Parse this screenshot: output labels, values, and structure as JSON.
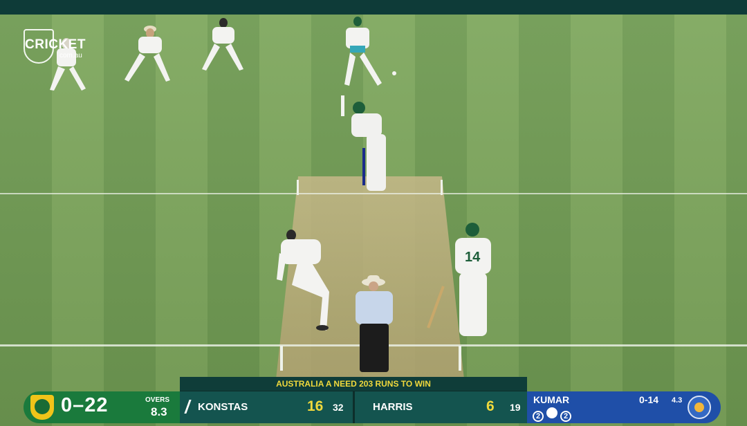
{
  "broadcast": {
    "logo_text": "CRICKET",
    "logo_sub": "com.au"
  },
  "scoreboard": {
    "team_score": "0–22",
    "overs_label": "OVERS",
    "overs_value": "8.3",
    "target_message": "AUSTRALIA A NEED 203 RUNS TO WIN",
    "batters": [
      {
        "name": "KONSTAS",
        "runs": "16",
        "balls": "32",
        "on_strike": true
      },
      {
        "name": "HARRIS",
        "runs": "6",
        "balls": "19",
        "on_strike": false
      }
    ],
    "bowler": {
      "name": "KUMAR",
      "figures": "0-14",
      "overs": "4.3",
      "this_over": [
        "2",
        "•",
        "2"
      ]
    }
  },
  "colors": {
    "australia_green": "#1a7a3c",
    "india_blue": "#1f4fa8",
    "target_yellow": "#f0d93c"
  }
}
